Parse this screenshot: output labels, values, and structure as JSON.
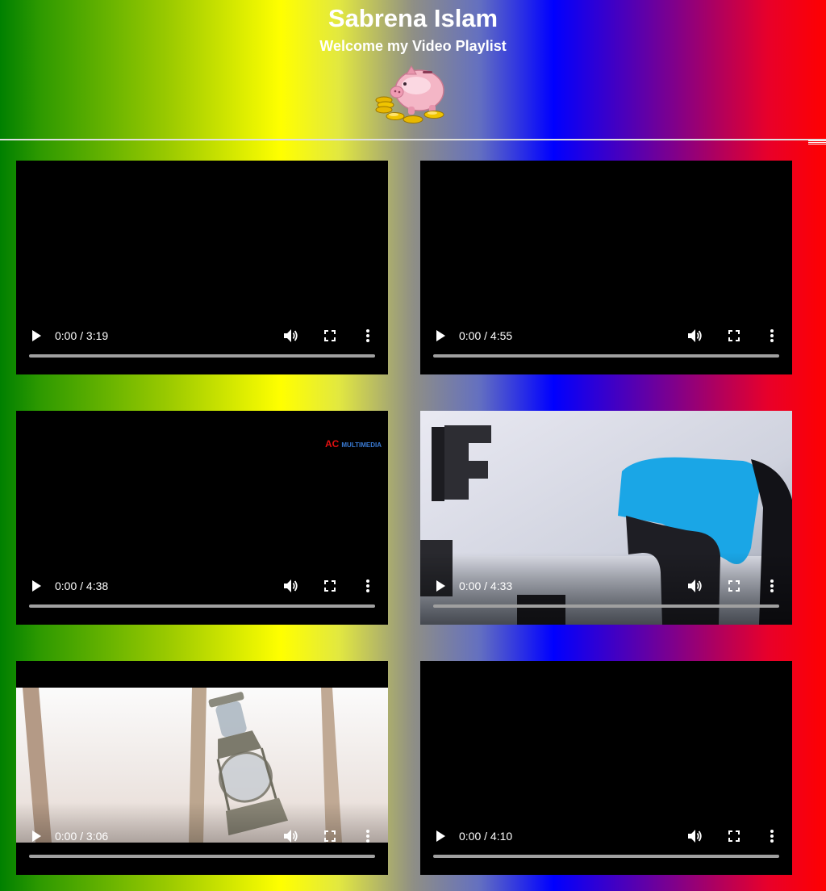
{
  "header": {
    "title": "Sabrena Islam",
    "subtitle": "Welcome my Video Playlist"
  },
  "videos": [
    {
      "time": "0:00 / 3:19",
      "poster": "black",
      "progress": 0
    },
    {
      "time": "0:00 / 4:55",
      "poster": "black",
      "progress": 0
    },
    {
      "time": "0:00 / 4:38",
      "poster": "black",
      "progress": 0,
      "watermark": {
        "ac": "AC",
        "multimedia": "MULTIMEDIA"
      }
    },
    {
      "time": "0:00 / 4:33",
      "poster": "3d-letters-frame",
      "progress": 0
    },
    {
      "time": "0:00 / 3:06",
      "poster": "lantern-frame",
      "progress": 0
    },
    {
      "time": "0:00 / 4:10",
      "poster": "black",
      "progress": 0
    }
  ],
  "icons": {
    "play": "play-icon",
    "volume": "volume-icon",
    "fullscreen": "fullscreen-icon",
    "more": "more-options-icon",
    "logo": "piggy-bank-coins-logo"
  },
  "colors": {
    "title": "#ffffff",
    "video_bg": "#000000",
    "progress_track": "#a0a0a0",
    "blue_letter": "#1aa6e6"
  }
}
